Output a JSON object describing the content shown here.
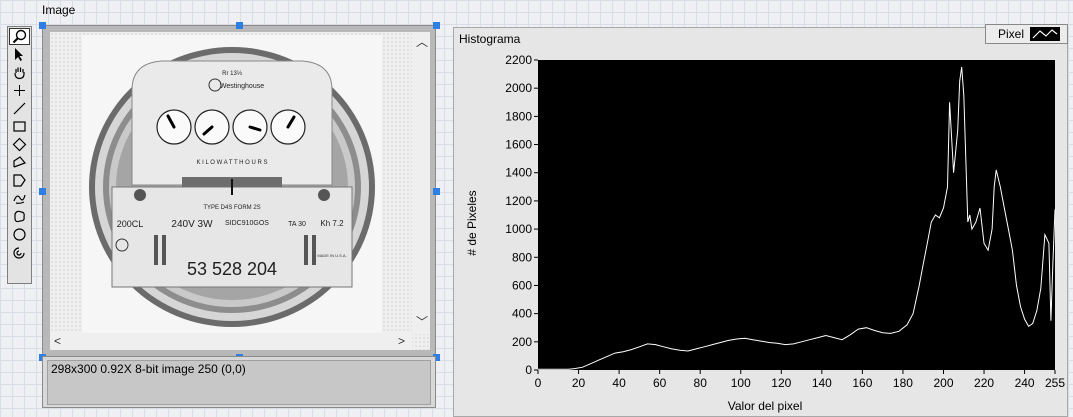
{
  "image_panel": {
    "label": "Image",
    "status": "298x300 0.92X 8-bit image 250    (0,0)",
    "meter_text": {
      "top_small": "Rr 13⅓",
      "brand": "Westinghouse",
      "kwh": "K I L O W A T T H O U R S",
      "type": "TYPE D4S   FORM 2S",
      "cl": "200CL",
      "volt": "240V 3W",
      "serial": "SIDC910GOS",
      "amp": "TA 30",
      "kh": "Kh 7.2",
      "made": "MADE IN U.S.A.",
      "reading": "53 528 204"
    }
  },
  "tools": [
    {
      "name": "zoom-tool-icon",
      "active": true
    },
    {
      "name": "pointer-tool-icon",
      "active": false
    },
    {
      "name": "pan-hand-icon",
      "active": false
    },
    {
      "name": "crosshair-point-icon",
      "active": false
    },
    {
      "name": "line-tool-icon",
      "active": false
    },
    {
      "name": "rectangle-tool-icon",
      "active": false
    },
    {
      "name": "rotated-rect-tool-icon",
      "active": false
    },
    {
      "name": "polyline-tool-icon",
      "active": false
    },
    {
      "name": "polygon-tool-icon",
      "active": false
    },
    {
      "name": "freehand-line-icon",
      "active": false
    },
    {
      "name": "freehand-region-icon",
      "active": false
    },
    {
      "name": "oval-tool-icon",
      "active": false
    },
    {
      "name": "annulus-tool-icon",
      "active": false
    }
  ],
  "histogram": {
    "title": "Histograma",
    "legend_label": "Pixel"
  },
  "colors": {
    "plot_bg": "#000000",
    "trace": "#ffffff",
    "handle": "#2d7fe4"
  },
  "chart_data": {
    "type": "line",
    "xlabel": "Valor del pixel",
    "ylabel": "# de Pixeles",
    "xlim": [
      0,
      255
    ],
    "ylim": [
      0,
      2200
    ],
    "xticks": [
      "0",
      "20",
      "40",
      "60",
      "80",
      "100",
      "120",
      "140",
      "160",
      "180",
      "200",
      "220",
      "240",
      "255"
    ],
    "yticks": [
      "0",
      "200",
      "400",
      "600",
      "800",
      "1000",
      "1200",
      "1400",
      "1600",
      "1800",
      "2000",
      "2200"
    ],
    "series": [
      {
        "x": [
          0,
          5,
          10,
          15,
          18,
          22,
          26,
          30,
          34,
          38,
          42,
          46,
          50,
          54,
          58,
          62,
          66,
          70,
          74,
          78,
          82,
          86,
          90,
          94,
          98,
          102,
          106,
          110,
          114,
          118,
          122,
          126,
          130,
          134,
          138,
          142,
          146,
          150,
          154,
          158,
          162,
          166,
          170,
          174,
          178,
          182,
          185,
          188,
          190,
          192,
          194,
          196,
          198,
          200,
          202,
          203,
          205,
          207,
          208,
          209,
          210,
          211,
          212,
          213,
          214,
          216,
          218,
          220,
          222,
          224,
          225,
          226,
          228,
          230,
          232,
          234,
          236,
          238,
          240,
          242,
          244,
          246,
          248,
          250,
          252,
          253,
          254,
          255
        ],
        "y": [
          5,
          5,
          5,
          6,
          10,
          20,
          45,
          70,
          95,
          120,
          130,
          145,
          165,
          185,
          180,
          165,
          150,
          140,
          135,
          150,
          165,
          180,
          195,
          210,
          220,
          225,
          215,
          205,
          195,
          190,
          180,
          185,
          200,
          215,
          230,
          245,
          230,
          215,
          250,
          290,
          300,
          280,
          265,
          260,
          275,
          320,
          400,
          600,
          750,
          900,
          1050,
          1100,
          1080,
          1150,
          1300,
          1900,
          1400,
          1700,
          2050,
          2150,
          1950,
          1500,
          1050,
          1100,
          1000,
          1050,
          1150,
          900,
          850,
          1000,
          1300,
          1420,
          1300,
          1150,
          1000,
          850,
          600,
          450,
          360,
          310,
          330,
          420,
          580,
          960,
          900,
          350,
          780,
          1140
        ]
      }
    ]
  }
}
